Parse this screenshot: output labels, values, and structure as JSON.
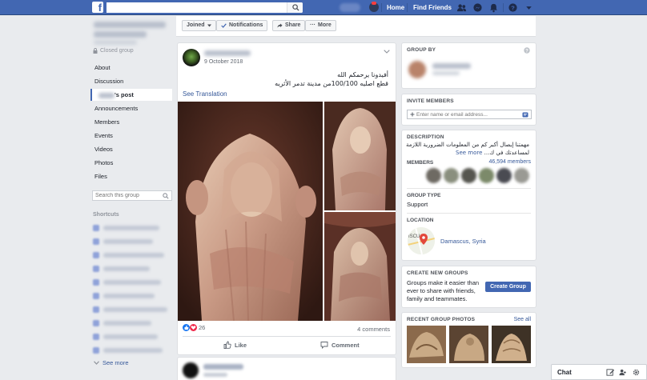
{
  "topbar": {
    "search_placeholder": "",
    "home": "Home",
    "find_friends": "Find Friends",
    "logo": "f"
  },
  "sidebar": {
    "closed_group": "Closed group",
    "items": [
      {
        "label": "About"
      },
      {
        "label": "Discussion"
      },
      {
        "label": "'s post",
        "active": true
      },
      {
        "label": "Announcements"
      },
      {
        "label": "Members"
      },
      {
        "label": "Events"
      },
      {
        "label": "Videos"
      },
      {
        "label": "Photos"
      },
      {
        "label": "Files"
      }
    ],
    "search_placeholder": "Search this group",
    "shortcuts_heading": "Shortcuts",
    "see_more": "See more"
  },
  "actionbar": {
    "joined": "Joined",
    "notifications": "Notifications",
    "share": "Share",
    "more": "More"
  },
  "post": {
    "date": "9 October 2018",
    "text_line1": "أفيدونا يرحمكم الله",
    "text_line2": "قطع اصليه 100/100من مدينة تدمر الأثريه",
    "see_translation": "See Translation",
    "reactions_count": "26",
    "comments": "4 comments",
    "like": "Like",
    "comment": "Comment"
  },
  "right": {
    "group_by": "GROUP BY",
    "invite_members": "INVITE MEMBERS",
    "invite_placeholder": "Enter name or email address...",
    "description_heading": "DESCRIPTION",
    "description_line1": "مهمتنا إيصال أكبر كم من المعلومات الضرورية اللازمة",
    "description_line2": "لمساعدتك في ك...",
    "description_see_more": "See more",
    "members_heading": "MEMBERS",
    "members_count": "46,594 members",
    "group_type_heading": "GROUP TYPE",
    "group_type": "Support",
    "location_heading": "LOCATION",
    "location": "Damascus, Syria",
    "map_text": "ISCU",
    "create_heading": "CREATE NEW GROUPS",
    "create_text": "Groups make it easier than ever to share with friends, family and teammates.",
    "create_button": "Create Group",
    "recent_photos": "RECENT GROUP PHOTOS",
    "see_all": "See all"
  },
  "chat": {
    "label": "Chat"
  },
  "colors": {
    "brand": "#4267b2",
    "link": "#365899",
    "background": "#e9ebee"
  }
}
